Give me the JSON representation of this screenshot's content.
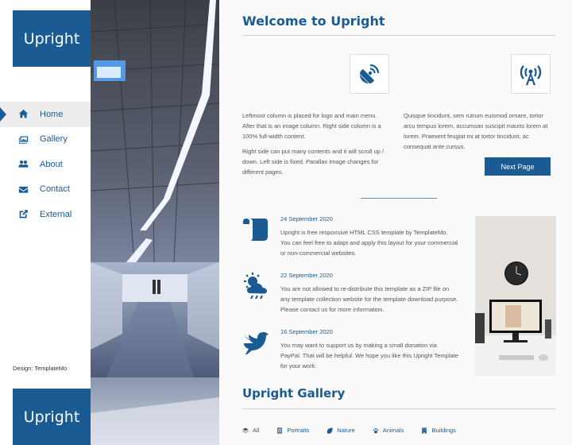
{
  "brand": {
    "name": "Upright"
  },
  "nav": {
    "items": [
      {
        "label": "Home",
        "icon": "home-icon",
        "active": true
      },
      {
        "label": "Gallery",
        "icon": "images-icon",
        "active": false
      },
      {
        "label": "About",
        "icon": "users-icon",
        "active": false
      },
      {
        "label": "Contact",
        "icon": "envelope-icon",
        "active": false
      },
      {
        "label": "External",
        "icon": "external-link-icon",
        "active": false
      }
    ]
  },
  "footer": {
    "credit": "Design: TemplateMo"
  },
  "main": {
    "title": "Welcome to Upright",
    "feature_icons": [
      "satellite-dish-icon",
      "broadcast-tower-icon"
    ],
    "left_paragraphs": [
      "Leftmost column is placed for logo and main menu. After that is an image column. Right side column is a 100% full-width content.",
      "Right side can put many contents and it will scroll up / down. Left side is fixed. Parallax Image changes for different pages."
    ],
    "right_paragraph": "Quisque tincidunt, sem rutrum euismod ornare, tortor arcu tempus lorem, accumsan suscipit mauris lorem at lorem. Praesent feugiat mi at tortor tincidunt, ac consequat ante cursus.",
    "next_button": "Next Page"
  },
  "posts": [
    {
      "icon": "scroll-icon",
      "date": "24 September 2020",
      "text": "Upright is free responsive HTML CSS template by TemplateMo. You can feel free to adapt and apply this layout for your commercial or non-commercial websites."
    },
    {
      "icon": "cloud-sun-rain-icon",
      "date": "22 September 2020",
      "text": "You are not allowed to re-distribute this template as a ZIP file on any template collection website for the template download purpose. Please contact us for more information."
    },
    {
      "icon": "dove-icon",
      "date": "16 September 2020",
      "text": "You may want to support us by making a small donation via PayPal. That will be helpful. We hope you like this Upright Template for your work."
    }
  ],
  "gallery": {
    "title": "Upright Gallery",
    "filters": [
      {
        "label": "All",
        "icon": "layers-icon"
      },
      {
        "label": "Portraits",
        "icon": "portrait-icon"
      },
      {
        "label": "Nature",
        "icon": "leaf-icon"
      },
      {
        "label": "Animals",
        "icon": "paw-icon"
      },
      {
        "label": "Buildings",
        "icon": "building-icon"
      }
    ]
  },
  "colors": {
    "accent": "#1b5b93",
    "active_bg": "#ededed",
    "content_bg": "#fafafa"
  }
}
